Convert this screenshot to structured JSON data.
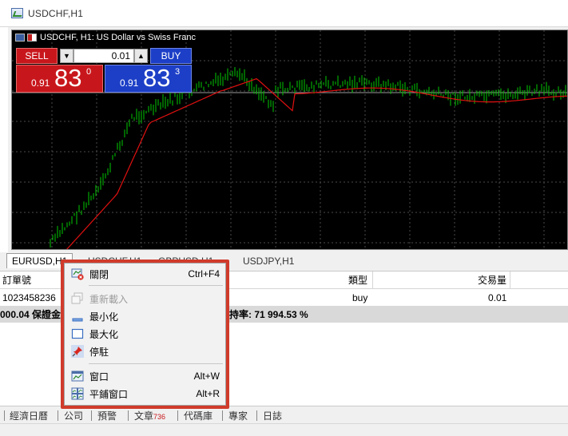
{
  "window": {
    "title": "USDCHF,H1"
  },
  "chart": {
    "title": "USDCHF, H1:  US Dollar vs Swiss Franc"
  },
  "trade": {
    "sell_label": "SELL",
    "buy_label": "BUY",
    "quantity": "0.01",
    "sell_price": {
      "small": "0.91",
      "big": "83",
      "sup": "0"
    },
    "buy_price": {
      "small": "0.91",
      "big": "83",
      "sup": "3"
    }
  },
  "chart_tabs": [
    {
      "label": "EURUSD,H1",
      "active": true
    },
    {
      "label": "USDCHF,H1",
      "active": false
    },
    {
      "label": "GBPUSD,H1",
      "active": false
    },
    {
      "label": "USDJPY,H1",
      "active": false
    }
  ],
  "terminal": {
    "headers": {
      "order": "訂單號",
      "type": "類型",
      "volume": "交易量"
    },
    "row": {
      "order": "1023458236",
      "type": "buy",
      "volume": "0.01"
    },
    "summary": {
      "left": "000.04  保證金",
      "right": "持率: 71 994.53 %"
    }
  },
  "bottom_tabs": [
    {
      "label": "經濟日曆"
    },
    {
      "label": "公司"
    },
    {
      "label": "預警"
    },
    {
      "label": "文章",
      "badge": "736"
    },
    {
      "label": "代碼庫"
    },
    {
      "label": "專家"
    },
    {
      "label": "日誌"
    }
  ],
  "context_menu": {
    "items": [
      {
        "label": "關閉",
        "shortcut": "Ctrl+F4",
        "icon": "close-chart-icon",
        "disabled": false
      },
      {
        "label": "重新載入",
        "shortcut": "",
        "icon": "reload-icon",
        "disabled": true
      },
      {
        "label": "最小化",
        "shortcut": "",
        "icon": "minimize-icon",
        "disabled": false
      },
      {
        "label": "最大化",
        "shortcut": "",
        "icon": "maximize-icon",
        "disabled": false
      },
      {
        "label": "停駐",
        "shortcut": "",
        "icon": "pin-icon",
        "disabled": false
      },
      {
        "label": "窗口",
        "shortcut": "Alt+W",
        "icon": "window-icon",
        "disabled": false
      },
      {
        "label": "平鋪窗口",
        "shortcut": "Alt+R",
        "icon": "tile-windows-icon",
        "disabled": false
      }
    ]
  },
  "colors": {
    "sell": "#c8171c",
    "buy": "#1d3fc7",
    "candle": "#00c800",
    "moving_average": "#e01010",
    "highlight": "#d03b2b"
  }
}
